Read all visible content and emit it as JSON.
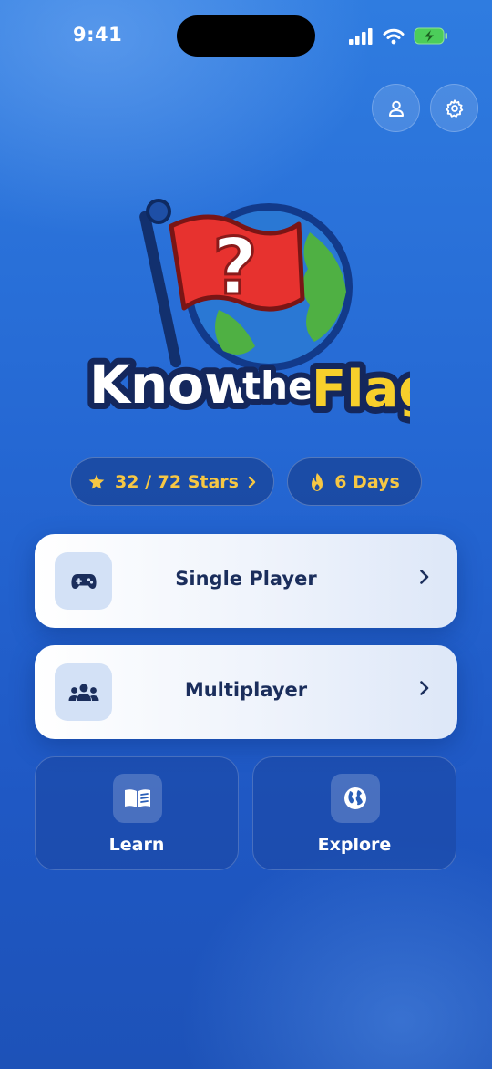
{
  "status": {
    "time": "9:41"
  },
  "header": {
    "profile_icon": "person-icon",
    "settings_icon": "gear-icon"
  },
  "logo": {
    "word1": "Know",
    "word2": "the",
    "word3": "Flag",
    "symbol": "?"
  },
  "stats": {
    "stars": "32 / 72 Stars",
    "streak": "6 Days"
  },
  "modes": [
    {
      "label": "Single Player",
      "icon": "gamepad-icon"
    },
    {
      "label": "Multiplayer",
      "icon": "users-icon"
    }
  ],
  "tiles": [
    {
      "label": "Learn",
      "icon": "book-icon"
    },
    {
      "label": "Explore",
      "icon": "globe-icon"
    }
  ],
  "colors": {
    "accent": "#f6c744",
    "card_text": "#1b2e5c",
    "background": "#2466d2"
  }
}
